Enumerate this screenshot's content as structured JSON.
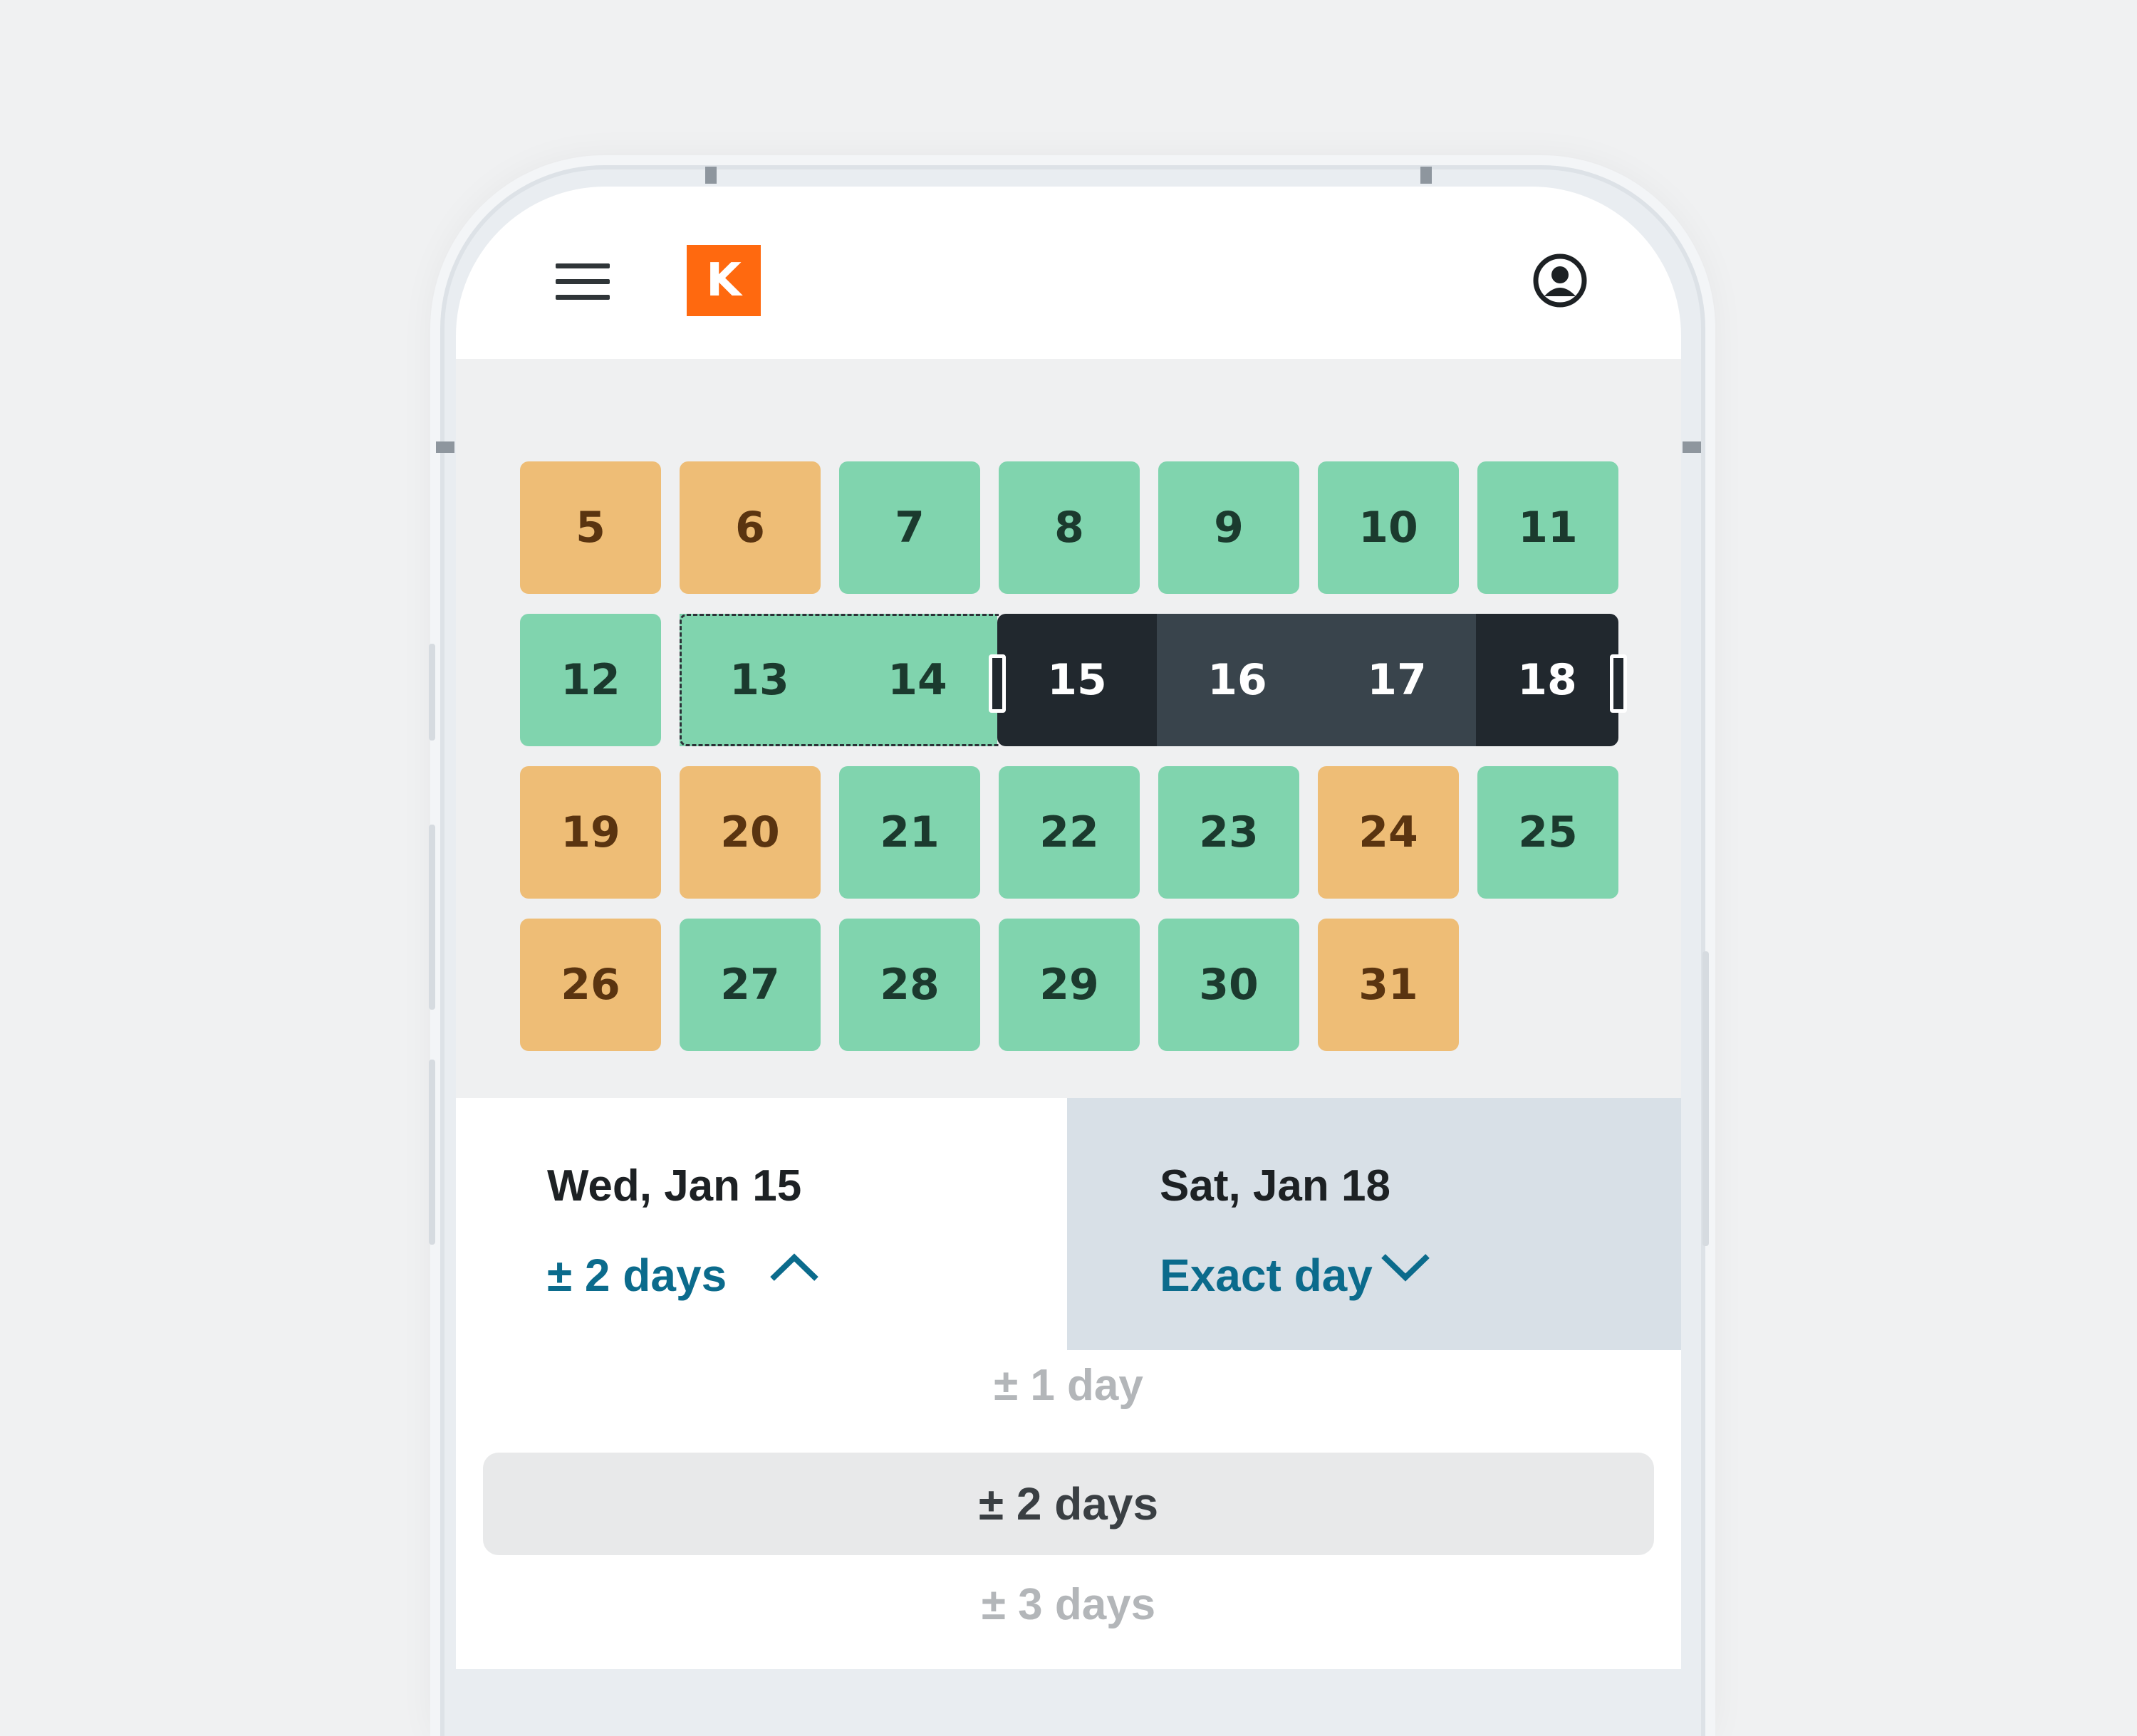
{
  "header": {
    "logo_letter": "K",
    "brand_color": "#ff690f",
    "icons": [
      "menu-icon",
      "profile-icon"
    ]
  },
  "calendar": {
    "rows": [
      [
        {
          "day": "5",
          "status": "orange"
        },
        {
          "day": "6",
          "status": "orange"
        },
        {
          "day": "7",
          "status": "green"
        },
        {
          "day": "8",
          "status": "green"
        },
        {
          "day": "9",
          "status": "green"
        },
        {
          "day": "10",
          "status": "green"
        },
        {
          "day": "11",
          "status": "green"
        }
      ],
      [
        {
          "day": "12",
          "status": "green"
        },
        {
          "day": "13",
          "status": "flex"
        },
        {
          "day": "14",
          "status": "flex"
        },
        {
          "day": "15",
          "status": "selected-start"
        },
        {
          "day": "16",
          "status": "selected-range"
        },
        {
          "day": "17",
          "status": "selected-range"
        },
        {
          "day": "18",
          "status": "selected-end"
        }
      ],
      [
        {
          "day": "19",
          "status": "orange"
        },
        {
          "day": "20",
          "status": "orange"
        },
        {
          "day": "21",
          "status": "green"
        },
        {
          "day": "22",
          "status": "green"
        },
        {
          "day": "23",
          "status": "green"
        },
        {
          "day": "24",
          "status": "orange"
        },
        {
          "day": "25",
          "status": "green"
        }
      ],
      [
        {
          "day": "26",
          "status": "orange"
        },
        {
          "day": "27",
          "status": "green"
        },
        {
          "day": "28",
          "status": "green"
        },
        {
          "day": "29",
          "status": "green"
        },
        {
          "day": "30",
          "status": "green"
        },
        {
          "day": "31",
          "status": "orange"
        }
      ]
    ],
    "colors": {
      "green": "#80d4ae",
      "orange": "#eebd76",
      "selected": "#21282e",
      "range": "#39444c"
    }
  },
  "departure": {
    "date": "Wed, Jan 15",
    "flex": "± 2 days",
    "chevron": "chevron-up-icon"
  },
  "return": {
    "date": "Sat, Jan 18",
    "flex": "Exact day",
    "chevron": "chevron-down-icon"
  },
  "flex_options": {
    "above": "± 1 day",
    "selected": "± 2 days",
    "below": "± 3 days"
  }
}
